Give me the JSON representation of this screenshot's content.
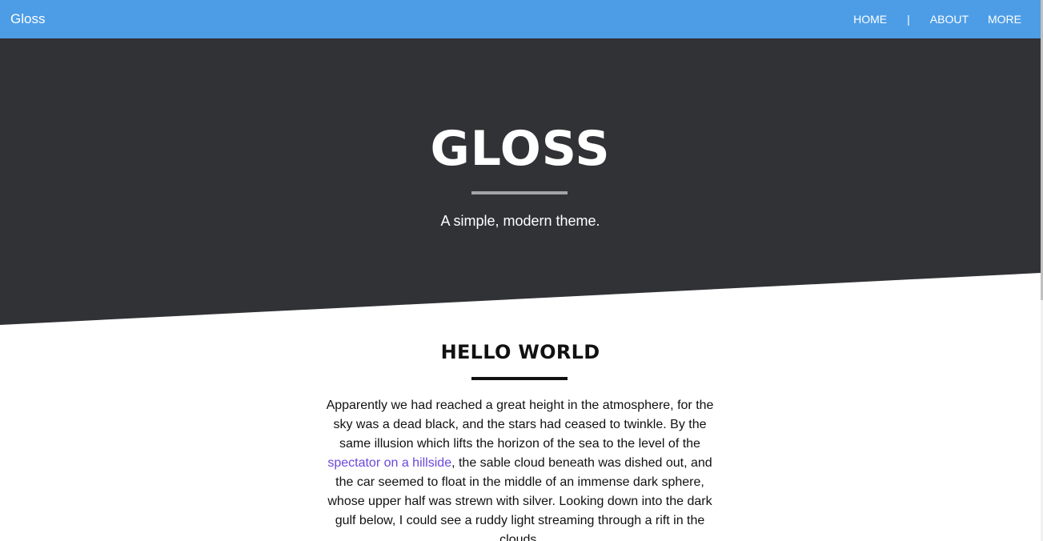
{
  "navbar": {
    "brand": "Gloss",
    "links": {
      "home": "HOME",
      "separator": "|",
      "about": "ABOUT",
      "more": "MORE"
    },
    "background_color": "#4d9de6"
  },
  "hero": {
    "title": "GLOSS",
    "subtitle": "A simple, modern theme.",
    "background_color": "#313236"
  },
  "post": {
    "title": "HELLO WORLD",
    "body_before_link": "Apparently we had reached a great height in the atmosphere, for the sky was a dead black, and the stars had ceased to twinkle. By the same illusion which lifts the horizon of the sea to the level of the ",
    "link_text": "spectator on a hillside",
    "body_after_link": ", the sable cloud beneath was dished out, and the car seemed to float in the middle of an immense dark sphere, whose upper half was strewn with silver. Looking down into the dark gulf below, I could see a ruddy light streaming through a rift in the clouds.",
    "link_color": "#6b47dc"
  }
}
